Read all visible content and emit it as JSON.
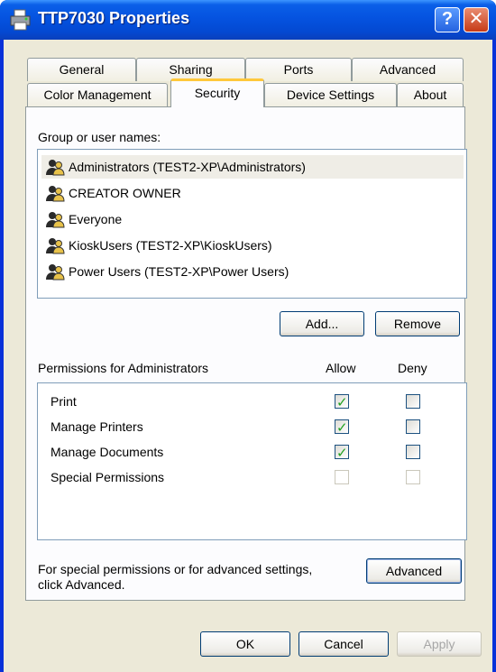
{
  "window": {
    "title": "TTP7030 Properties",
    "help_label": "?",
    "close_label": "✕"
  },
  "tabs": {
    "row1": [
      "General",
      "Sharing",
      "Ports",
      "Advanced"
    ],
    "row2": [
      "Color Management",
      "Security",
      "Device Settings",
      "About"
    ],
    "active": "Security"
  },
  "group_label": "Group or user names:",
  "users": [
    {
      "name": "Administrators (TEST2-XP\\Administrators)",
      "selected": true
    },
    {
      "name": "CREATOR OWNER",
      "selected": false
    },
    {
      "name": "Everyone",
      "selected": false
    },
    {
      "name": "KioskUsers (TEST2-XP\\KioskUsers)",
      "selected": false
    },
    {
      "name": "Power Users (TEST2-XP\\Power Users)",
      "selected": false
    }
  ],
  "add_button": "Add...",
  "remove_button": "Remove",
  "permissions_label": "Permissions for Administrators",
  "allow_header": "Allow",
  "deny_header": "Deny",
  "permissions": [
    {
      "name": "Print",
      "allow": true,
      "deny": false,
      "enabled": true
    },
    {
      "name": "Manage Printers",
      "allow": true,
      "deny": false,
      "enabled": true
    },
    {
      "name": "Manage Documents",
      "allow": true,
      "deny": false,
      "enabled": true
    },
    {
      "name": "Special Permissions",
      "allow": false,
      "deny": false,
      "enabled": false
    }
  ],
  "special_text_line1": "For special permissions or for advanced settings,",
  "special_text_line2": "click Advanced.",
  "advanced_button": "Advanced",
  "ok_button": "OK",
  "cancel_button": "Cancel",
  "apply_button": "Apply",
  "colors": {
    "titlebar": "#0553e0",
    "face": "#ece9d8",
    "selection": "#efede6",
    "check": "#21a121",
    "active_tab": "#ffc83c"
  }
}
